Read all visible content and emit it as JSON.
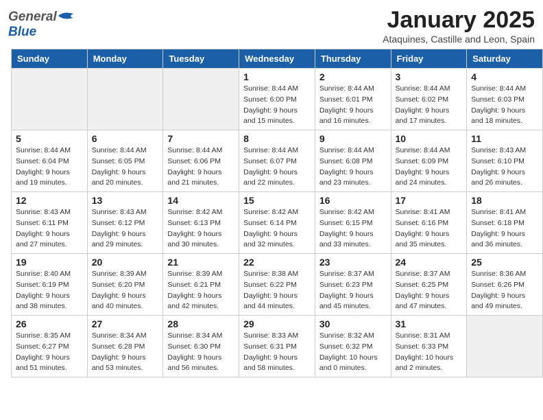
{
  "header": {
    "logo_general": "General",
    "logo_blue": "Blue",
    "main_title": "January 2025",
    "sub_title": "Ataquines, Castille and Leon, Spain"
  },
  "weekdays": [
    "Sunday",
    "Monday",
    "Tuesday",
    "Wednesday",
    "Thursday",
    "Friday",
    "Saturday"
  ],
  "weeks": [
    [
      {
        "day": "",
        "info": "",
        "empty": true
      },
      {
        "day": "",
        "info": "",
        "empty": true
      },
      {
        "day": "",
        "info": "",
        "empty": true
      },
      {
        "day": "1",
        "info": "Sunrise: 8:44 AM\nSunset: 6:00 PM\nDaylight: 9 hours\nand 15 minutes.",
        "empty": false
      },
      {
        "day": "2",
        "info": "Sunrise: 8:44 AM\nSunset: 6:01 PM\nDaylight: 9 hours\nand 16 minutes.",
        "empty": false
      },
      {
        "day": "3",
        "info": "Sunrise: 8:44 AM\nSunset: 6:02 PM\nDaylight: 9 hours\nand 17 minutes.",
        "empty": false
      },
      {
        "day": "4",
        "info": "Sunrise: 8:44 AM\nSunset: 6:03 PM\nDaylight: 9 hours\nand 18 minutes.",
        "empty": false
      }
    ],
    [
      {
        "day": "5",
        "info": "Sunrise: 8:44 AM\nSunset: 6:04 PM\nDaylight: 9 hours\nand 19 minutes.",
        "empty": false
      },
      {
        "day": "6",
        "info": "Sunrise: 8:44 AM\nSunset: 6:05 PM\nDaylight: 9 hours\nand 20 minutes.",
        "empty": false
      },
      {
        "day": "7",
        "info": "Sunrise: 8:44 AM\nSunset: 6:06 PM\nDaylight: 9 hours\nand 21 minutes.",
        "empty": false
      },
      {
        "day": "8",
        "info": "Sunrise: 8:44 AM\nSunset: 6:07 PM\nDaylight: 9 hours\nand 22 minutes.",
        "empty": false
      },
      {
        "day": "9",
        "info": "Sunrise: 8:44 AM\nSunset: 6:08 PM\nDaylight: 9 hours\nand 23 minutes.",
        "empty": false
      },
      {
        "day": "10",
        "info": "Sunrise: 8:44 AM\nSunset: 6:09 PM\nDaylight: 9 hours\nand 24 minutes.",
        "empty": false
      },
      {
        "day": "11",
        "info": "Sunrise: 8:43 AM\nSunset: 6:10 PM\nDaylight: 9 hours\nand 26 minutes.",
        "empty": false
      }
    ],
    [
      {
        "day": "12",
        "info": "Sunrise: 8:43 AM\nSunset: 6:11 PM\nDaylight: 9 hours\nand 27 minutes.",
        "empty": false
      },
      {
        "day": "13",
        "info": "Sunrise: 8:43 AM\nSunset: 6:12 PM\nDaylight: 9 hours\nand 29 minutes.",
        "empty": false
      },
      {
        "day": "14",
        "info": "Sunrise: 8:42 AM\nSunset: 6:13 PM\nDaylight: 9 hours\nand 30 minutes.",
        "empty": false
      },
      {
        "day": "15",
        "info": "Sunrise: 8:42 AM\nSunset: 6:14 PM\nDaylight: 9 hours\nand 32 minutes.",
        "empty": false
      },
      {
        "day": "16",
        "info": "Sunrise: 8:42 AM\nSunset: 6:15 PM\nDaylight: 9 hours\nand 33 minutes.",
        "empty": false
      },
      {
        "day": "17",
        "info": "Sunrise: 8:41 AM\nSunset: 6:16 PM\nDaylight: 9 hours\nand 35 minutes.",
        "empty": false
      },
      {
        "day": "18",
        "info": "Sunrise: 8:41 AM\nSunset: 6:18 PM\nDaylight: 9 hours\nand 36 minutes.",
        "empty": false
      }
    ],
    [
      {
        "day": "19",
        "info": "Sunrise: 8:40 AM\nSunset: 6:19 PM\nDaylight: 9 hours\nand 38 minutes.",
        "empty": false
      },
      {
        "day": "20",
        "info": "Sunrise: 8:39 AM\nSunset: 6:20 PM\nDaylight: 9 hours\nand 40 minutes.",
        "empty": false
      },
      {
        "day": "21",
        "info": "Sunrise: 8:39 AM\nSunset: 6:21 PM\nDaylight: 9 hours\nand 42 minutes.",
        "empty": false
      },
      {
        "day": "22",
        "info": "Sunrise: 8:38 AM\nSunset: 6:22 PM\nDaylight: 9 hours\nand 44 minutes.",
        "empty": false
      },
      {
        "day": "23",
        "info": "Sunrise: 8:37 AM\nSunset: 6:23 PM\nDaylight: 9 hours\nand 45 minutes.",
        "empty": false
      },
      {
        "day": "24",
        "info": "Sunrise: 8:37 AM\nSunset: 6:25 PM\nDaylight: 9 hours\nand 47 minutes.",
        "empty": false
      },
      {
        "day": "25",
        "info": "Sunrise: 8:36 AM\nSunset: 6:26 PM\nDaylight: 9 hours\nand 49 minutes.",
        "empty": false
      }
    ],
    [
      {
        "day": "26",
        "info": "Sunrise: 8:35 AM\nSunset: 6:27 PM\nDaylight: 9 hours\nand 51 minutes.",
        "empty": false
      },
      {
        "day": "27",
        "info": "Sunrise: 8:34 AM\nSunset: 6:28 PM\nDaylight: 9 hours\nand 53 minutes.",
        "empty": false
      },
      {
        "day": "28",
        "info": "Sunrise: 8:34 AM\nSunset: 6:30 PM\nDaylight: 9 hours\nand 56 minutes.",
        "empty": false
      },
      {
        "day": "29",
        "info": "Sunrise: 8:33 AM\nSunset: 6:31 PM\nDaylight: 9 hours\nand 58 minutes.",
        "empty": false
      },
      {
        "day": "30",
        "info": "Sunrise: 8:32 AM\nSunset: 6:32 PM\nDaylight: 10 hours\nand 0 minutes.",
        "empty": false
      },
      {
        "day": "31",
        "info": "Sunrise: 8:31 AM\nSunset: 6:33 PM\nDaylight: 10 hours\nand 2 minutes.",
        "empty": false
      },
      {
        "day": "",
        "info": "",
        "empty": true
      }
    ]
  ]
}
